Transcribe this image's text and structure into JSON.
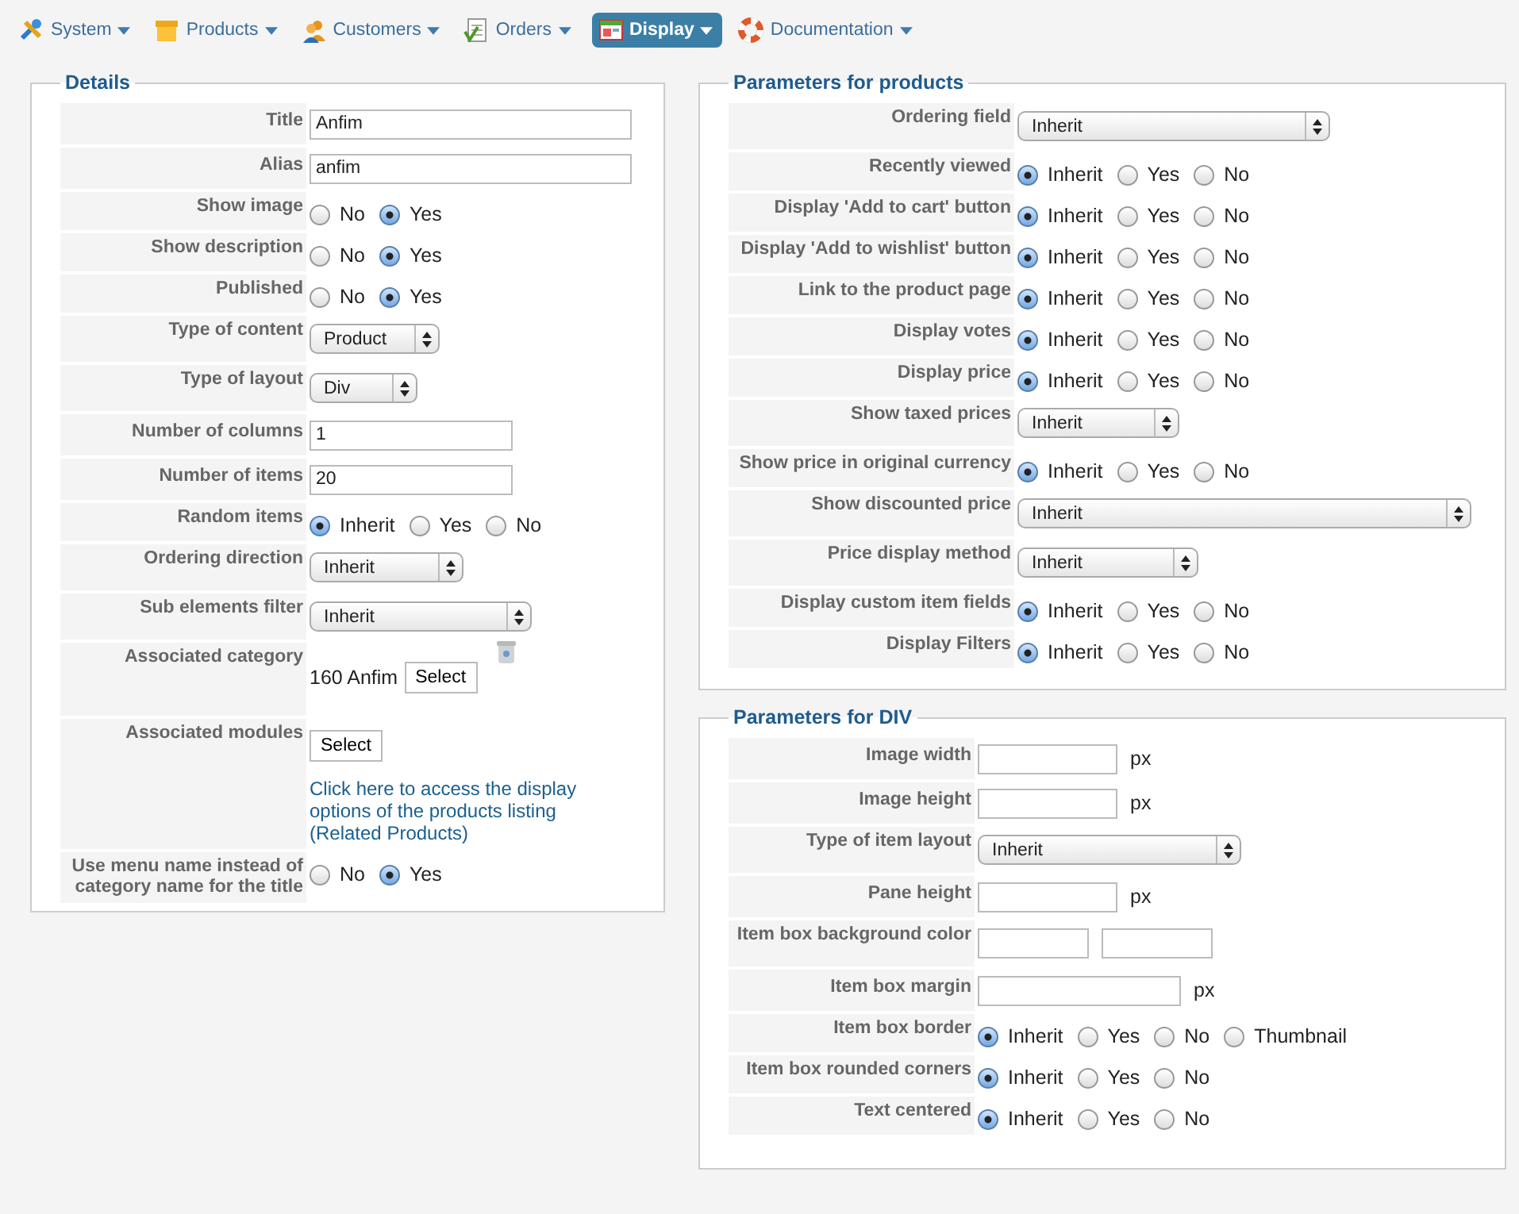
{
  "menu": [
    {
      "label": "System",
      "selected": false
    },
    {
      "label": "Products",
      "selected": false
    },
    {
      "label": "Customers",
      "selected": false
    },
    {
      "label": "Orders",
      "selected": false
    },
    {
      "label": "Display",
      "selected": true
    },
    {
      "label": "Documentation",
      "selected": false
    }
  ],
  "sections": [
    {
      "title": "Details",
      "rows": [
        {
          "label": "Title",
          "kind": "text",
          "value": "Anfim"
        },
        {
          "label": "Alias",
          "kind": "text",
          "value": "anfim"
        },
        {
          "label": "Show image",
          "kind": "radio",
          "options": [
            {
              "label": "No",
              "selected": false
            },
            {
              "label": "Yes",
              "selected": true
            }
          ]
        },
        {
          "label": "Show description",
          "kind": "radio",
          "options": [
            {
              "label": "No",
              "selected": false
            },
            {
              "label": "Yes",
              "selected": true
            }
          ]
        },
        {
          "label": "Published",
          "kind": "radio",
          "options": [
            {
              "label": "No",
              "selected": false
            },
            {
              "label": "Yes",
              "selected": true
            }
          ]
        },
        {
          "label": "Type of content",
          "kind": "select",
          "value": "Product"
        },
        {
          "label": "Type of layout",
          "kind": "select",
          "value": "Div"
        },
        {
          "label": "Number of columns",
          "kind": "text",
          "value": "1"
        },
        {
          "label": "Number of items",
          "kind": "text",
          "value": "20"
        },
        {
          "label": "Random items",
          "kind": "radio",
          "options": [
            {
              "label": "Inherit",
              "selected": true
            },
            {
              "label": "Yes",
              "selected": false
            },
            {
              "label": "No",
              "selected": false
            }
          ]
        },
        {
          "label": "Ordering direction",
          "kind": "select",
          "value": "Inherit"
        },
        {
          "label": "Sub elements filter",
          "kind": "select",
          "value": "Inherit"
        },
        {
          "label": "Associated category",
          "kind": "category",
          "value": "160 Anfim",
          "button": "Select"
        },
        {
          "label": "Associated modules",
          "kind": "modules",
          "button": "Select",
          "link": "Click here to access the display options of the products listing (Related Products)"
        },
        {
          "label": "Use menu name instead of category name for the title",
          "kind": "radio",
          "options": [
            {
              "label": "No",
              "selected": false
            },
            {
              "label": "Yes",
              "selected": true
            }
          ]
        }
      ]
    },
    {
      "title": "Parameters for products",
      "rows": [
        {
          "label": "Ordering field",
          "kind": "select",
          "value": "Inherit"
        },
        {
          "label": "Recently viewed",
          "kind": "radio",
          "options": [
            {
              "label": "Inherit",
              "selected": true
            },
            {
              "label": "Yes",
              "selected": false
            },
            {
              "label": "No",
              "selected": false
            }
          ]
        },
        {
          "label": "Display 'Add to cart' button",
          "kind": "radio",
          "options": [
            {
              "label": "Inherit",
              "selected": true
            },
            {
              "label": "Yes",
              "selected": false
            },
            {
              "label": "No",
              "selected": false
            }
          ]
        },
        {
          "label": "Display 'Add to wishlist' button",
          "kind": "radio",
          "options": [
            {
              "label": "Inherit",
              "selected": true
            },
            {
              "label": "Yes",
              "selected": false
            },
            {
              "label": "No",
              "selected": false
            }
          ]
        },
        {
          "label": "Link to the product page",
          "kind": "radio",
          "options": [
            {
              "label": "Inherit",
              "selected": true
            },
            {
              "label": "Yes",
              "selected": false
            },
            {
              "label": "No",
              "selected": false
            }
          ]
        },
        {
          "label": "Display votes",
          "kind": "radio",
          "options": [
            {
              "label": "Inherit",
              "selected": true
            },
            {
              "label": "Yes",
              "selected": false
            },
            {
              "label": "No",
              "selected": false
            }
          ]
        },
        {
          "label": "Display price",
          "kind": "radio",
          "options": [
            {
              "label": "Inherit",
              "selected": true
            },
            {
              "label": "Yes",
              "selected": false
            },
            {
              "label": "No",
              "selected": false
            }
          ]
        },
        {
          "label": "Show taxed prices",
          "kind": "select",
          "value": "Inherit"
        },
        {
          "label": "Show price in original currency",
          "kind": "radio",
          "options": [
            {
              "label": "Inherit",
              "selected": true
            },
            {
              "label": "Yes",
              "selected": false
            },
            {
              "label": "No",
              "selected": false
            }
          ]
        },
        {
          "label": "Show discounted price",
          "kind": "select",
          "value": "Inherit"
        },
        {
          "label": "Price display method",
          "kind": "select",
          "value": "Inherit"
        },
        {
          "label": "Display custom item fields",
          "kind": "radio",
          "options": [
            {
              "label": "Inherit",
              "selected": true
            },
            {
              "label": "Yes",
              "selected": false
            },
            {
              "label": "No",
              "selected": false
            }
          ]
        },
        {
          "label": "Display Filters",
          "kind": "radio",
          "options": [
            {
              "label": "Inherit",
              "selected": true
            },
            {
              "label": "Yes",
              "selected": false
            },
            {
              "label": "No",
              "selected": false
            }
          ]
        }
      ]
    },
    {
      "title": "Parameters for DIV",
      "rows": [
        {
          "label": "Image width",
          "kind": "px",
          "unit": "px"
        },
        {
          "label": "Image height",
          "kind": "px",
          "unit": "px"
        },
        {
          "label": "Type of item layout",
          "kind": "select",
          "value": "Inherit"
        },
        {
          "label": "Pane height",
          "kind": "px",
          "unit": "px"
        },
        {
          "label": "Item box background color",
          "kind": "color"
        },
        {
          "label": "Item box margin",
          "kind": "px",
          "unit": "px"
        },
        {
          "label": "Item box border",
          "kind": "radio",
          "options": [
            {
              "label": "Inherit",
              "selected": true
            },
            {
              "label": "Yes",
              "selected": false
            },
            {
              "label": "No",
              "selected": false
            },
            {
              "label": "Thumbnail",
              "selected": false
            }
          ]
        },
        {
          "label": "Item box rounded corners",
          "kind": "radio",
          "options": [
            {
              "label": "Inherit",
              "selected": true
            },
            {
              "label": "Yes",
              "selected": false
            },
            {
              "label": "No",
              "selected": false
            }
          ]
        },
        {
          "label": "Text centered",
          "kind": "radio",
          "options": [
            {
              "label": "Inherit",
              "selected": true
            },
            {
              "label": "Yes",
              "selected": false
            },
            {
              "label": "No",
              "selected": false
            }
          ]
        }
      ]
    }
  ]
}
